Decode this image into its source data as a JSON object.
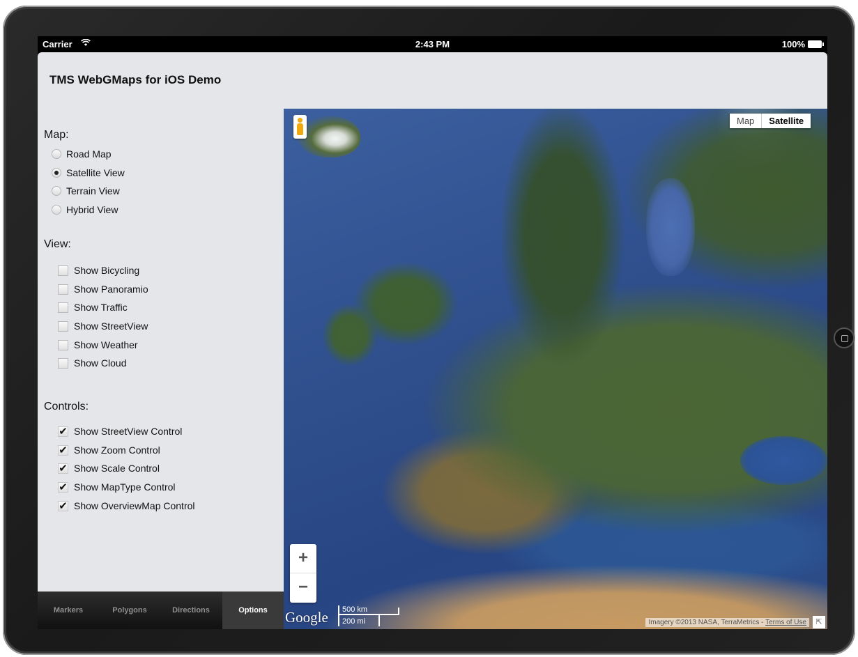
{
  "status_bar": {
    "carrier": "Carrier",
    "time": "2:43 PM",
    "battery": "100%"
  },
  "app": {
    "title": "TMS WebGMaps for iOS Demo"
  },
  "sidebar": {
    "map_section": {
      "title": "Map:",
      "options": [
        {
          "label": "Road Map",
          "selected": false
        },
        {
          "label": "Satellite View",
          "selected": true
        },
        {
          "label": "Terrain View",
          "selected": false
        },
        {
          "label": "Hybrid View",
          "selected": false
        }
      ]
    },
    "view_section": {
      "title": "View:",
      "items": [
        {
          "label": "Show Bicycling",
          "checked": false
        },
        {
          "label": "Show Panoramio",
          "checked": false
        },
        {
          "label": "Show Traffic",
          "checked": false
        },
        {
          "label": "Show StreetView",
          "checked": false
        },
        {
          "label": "Show Weather",
          "checked": false
        },
        {
          "label": "Show Cloud",
          "checked": false
        }
      ]
    },
    "controls_section": {
      "title": "Controls:",
      "items": [
        {
          "label": "Show StreetView Control",
          "checked": true
        },
        {
          "label": "Show Zoom Control",
          "checked": true
        },
        {
          "label": "Show Scale Control",
          "checked": true
        },
        {
          "label": "Show MapType Control",
          "checked": true
        },
        {
          "label": "Show OverviewMap Control",
          "checked": true
        }
      ]
    }
  },
  "tab_bar": {
    "tabs": [
      {
        "label": "Markers",
        "active": false
      },
      {
        "label": "Polygons",
        "active": false
      },
      {
        "label": "Directions",
        "active": false
      },
      {
        "label": "Options",
        "active": true
      }
    ]
  },
  "map": {
    "map_type": {
      "map_label": "Map",
      "satellite_label": "Satellite",
      "selected": "Satellite"
    },
    "zoom": {
      "in": "+",
      "out": "−"
    },
    "logo": "Google",
    "scale": {
      "km": "500 km",
      "mi": "200 mi"
    },
    "attribution": "Imagery ©2013 NASA, TerraMetrics - ",
    "terms": "Terms of Use",
    "overview_toggle": "⇱"
  },
  "colors": {
    "panel_bg": "#e4e6ea",
    "tab_bar_bg": "#1c1c1c",
    "active_tab_bg": "#3a3a3a",
    "ocean": "#2f4f8d"
  }
}
